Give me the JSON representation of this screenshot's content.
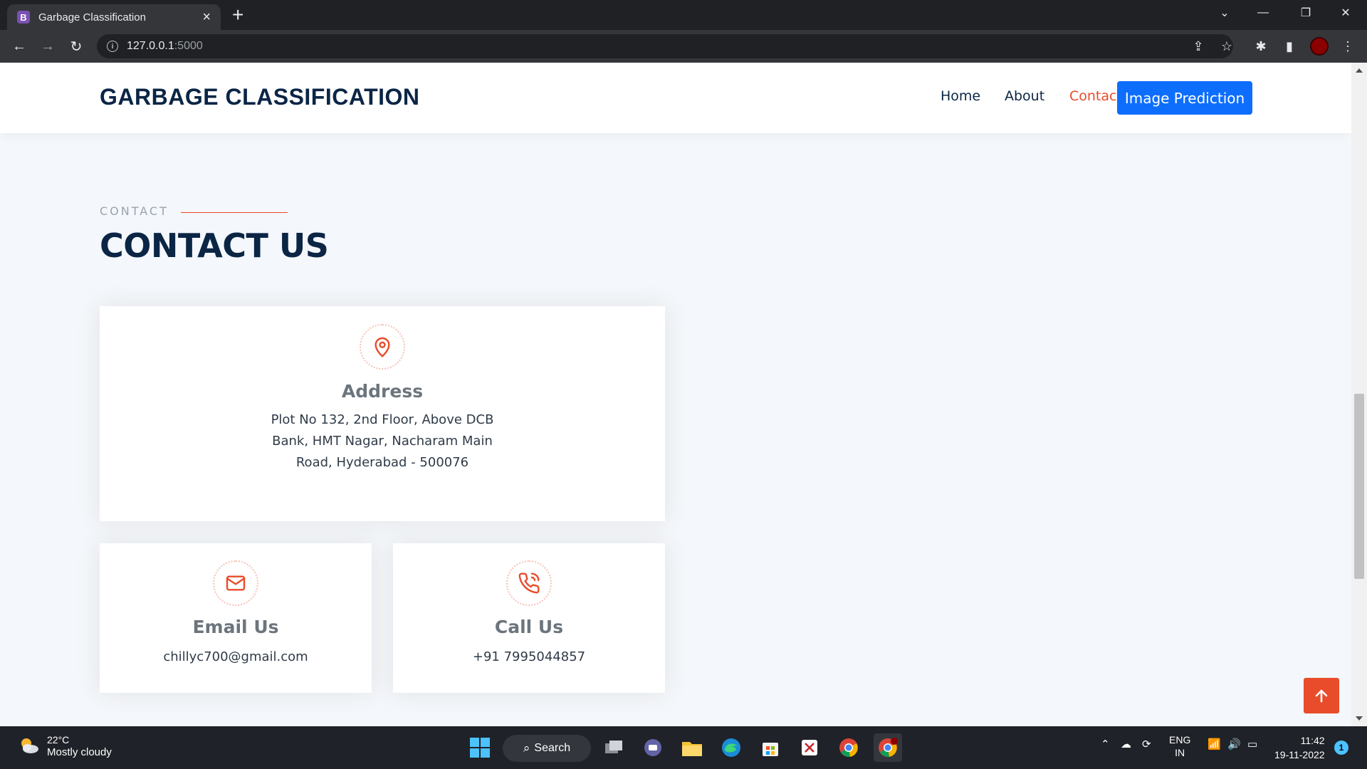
{
  "browser": {
    "tab_title": "Garbage Classification",
    "tab_favicon": "B",
    "url_host": "127.0.0.1",
    "url_port": ":5000"
  },
  "header": {
    "logo": "GARBAGE CLASSIFICATION",
    "nav": [
      "Home",
      "About",
      "Contact"
    ],
    "active_nav": "Contact",
    "cta": "Image Prediction"
  },
  "section": {
    "label": "CONTACT",
    "title": "CONTACT US"
  },
  "cards": {
    "address": {
      "title": "Address",
      "lines": [
        "Plot No 132, 2nd Floor, Above DCB",
        "Bank, HMT Nagar, Nacharam Main",
        "Road, Hyderabad - 500076"
      ],
      "icon": "map-pin-icon"
    },
    "email": {
      "title": "Email Us",
      "value": "chillyc700@gmail.com",
      "icon": "envelope-icon"
    },
    "call": {
      "title": "Call Us",
      "value": "+91 7995044857",
      "icon": "phone-icon"
    }
  },
  "taskbar": {
    "temperature": "22°C",
    "weather": "Mostly cloudy",
    "search_label": "Search",
    "lang_top": "ENG",
    "lang_bottom": "IN",
    "time": "11:42",
    "date": "19-11-2022",
    "notifications": "1"
  },
  "colors": {
    "accent": "#e84c2b",
    "navy": "#0b2545",
    "primary_button": "#0d6efd"
  }
}
